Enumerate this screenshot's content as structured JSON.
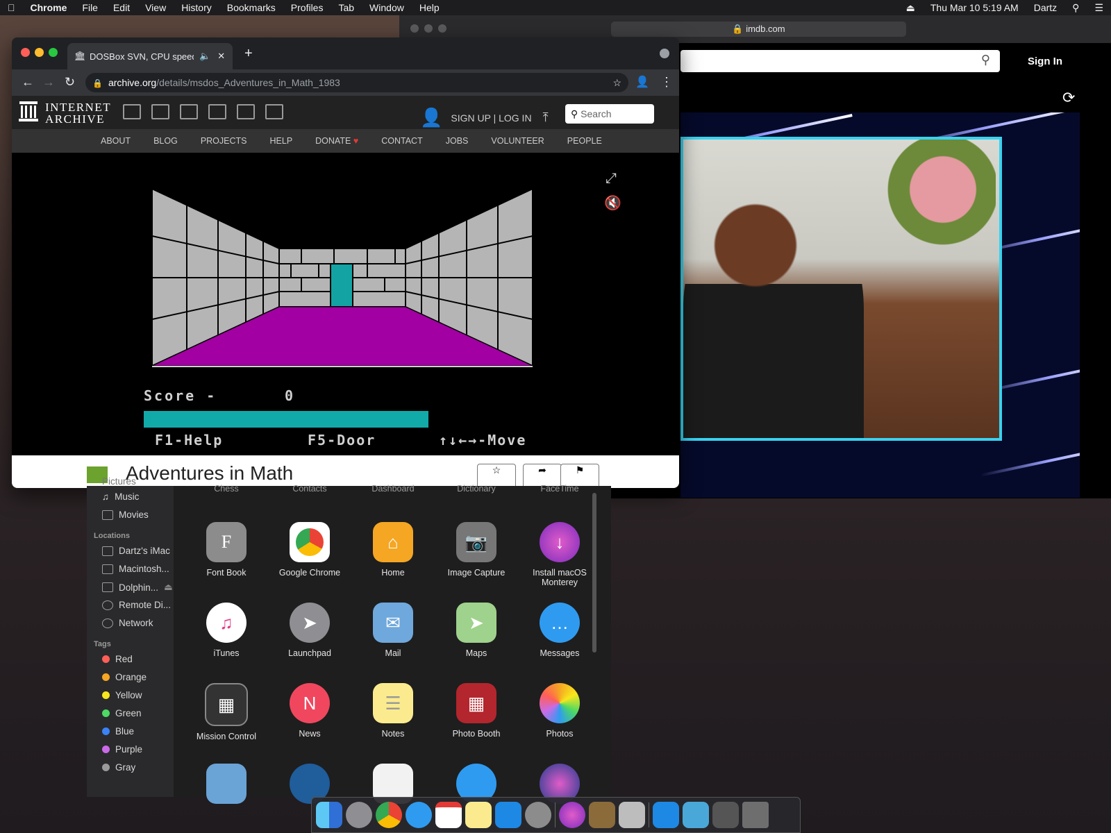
{
  "menubar": {
    "app": "Chrome",
    "items": [
      "File",
      "Edit",
      "View",
      "History",
      "Bookmarks",
      "Profiles",
      "Tab",
      "Window",
      "Help"
    ],
    "clock": "Thu Mar 10  5:19 AM",
    "user": "Dartz"
  },
  "safari": {
    "url": "imdb.com",
    "sign_in": "Sign In"
  },
  "chrome": {
    "tab_title": "DOSBox SVN, CPU speed:",
    "url_host": "archive.org",
    "url_path": "/details/msdos_Adventures_in_Math_1983"
  },
  "archive": {
    "logo_line1": "INTERNET",
    "logo_line2": "ARCHIVE",
    "login": "SIGN UP | LOG IN",
    "search_placeholder": "Search",
    "nav": [
      "ABOUT",
      "BLOG",
      "PROJECTS",
      "HELP",
      "DONATE",
      "CONTACT",
      "JOBS",
      "VOLUNTEER",
      "PEOPLE"
    ],
    "item_title": "Adventures in Math"
  },
  "game": {
    "score_label": "Score -",
    "score_value": "0",
    "key_help": "F1-Help",
    "key_door": "F5-Door",
    "key_move": "↑↓←→-Move"
  },
  "finder": {
    "sidebar_partial": "Pictures",
    "favorites": [
      "Music",
      "Movies"
    ],
    "locations_header": "Locations",
    "locations": [
      "Dartz's iMac",
      "Macintosh...",
      "Dolphin...",
      "Remote Di...",
      "Network"
    ],
    "tags_header": "Tags",
    "tags": [
      {
        "name": "Red",
        "color": "#ff5f57"
      },
      {
        "name": "Orange",
        "color": "#f5a623"
      },
      {
        "name": "Yellow",
        "color": "#f8e71c"
      },
      {
        "name": "Green",
        "color": "#4cd964"
      },
      {
        "name": "Blue",
        "color": "#3b82f6"
      },
      {
        "name": "Purple",
        "color": "#c96be8"
      },
      {
        "name": "Gray",
        "color": "#9a9a9a"
      }
    ],
    "column_headers": [
      "Chess",
      "Contacts",
      "Dashboard",
      "Dictionary",
      "FaceTime"
    ],
    "apps": [
      [
        "Font Book",
        "Google Chrome",
        "Home",
        "Image Capture",
        "Install macOS Monterey"
      ],
      [
        "iTunes",
        "Launchpad",
        "Mail",
        "Maps",
        "Messages"
      ],
      [
        "Mission Control",
        "News",
        "Notes",
        "Photo Booth",
        "Photos"
      ]
    ]
  }
}
